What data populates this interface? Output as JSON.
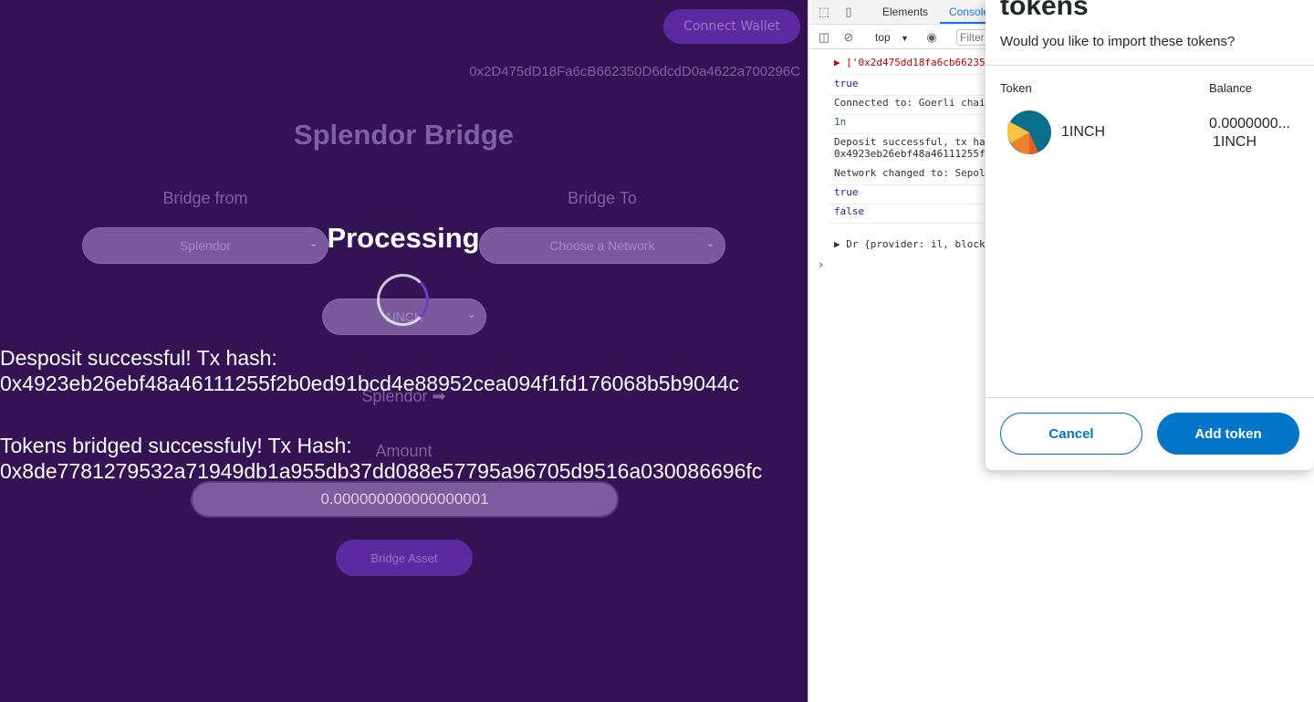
{
  "app": {
    "connect_button": "Connect Wallet",
    "wallet_address": "0x2D475dD18Fa6cB662350D6dcdD0a4622a700296C",
    "title": "Splendor Bridge",
    "bridge_from_label": "Bridge from",
    "bridge_to_label": "Bridge To",
    "from_network": "Splendor",
    "to_network": "Choose a Network",
    "processing_text": "Processing",
    "token_select": "1INCH",
    "direction_text": "Splendor ➡",
    "amount_label": "Amount",
    "amount_value": "0.000000000000000001",
    "bridge_button": "Bridge Asset",
    "deposit_msg_line1": "Desposit successful! Tx hash:",
    "deposit_msg_line2": "0x4923eb26ebf48a46111255f2b0ed91bcd4e88952cea094f1fd176068b5b9044c",
    "bridged_msg_line1": "Tokens bridged successfuly! Tx Hash:",
    "bridged_msg_line2": "0x8de7781279532a71949db1a955db37dd088e57795a96705d9516a030086696fc"
  },
  "devtools": {
    "tabs": [
      "Elements",
      "Console"
    ],
    "active_tab": "Console",
    "context": "top",
    "filter_placeholder": "Filter",
    "console_lines": [
      {
        "text": "▶ ['0x2d475dd18fa6cb66235",
        "color": "#c80000"
      },
      {
        "text": "true",
        "color": "#1a1aa6"
      },
      {
        "text": "Connected to: Goerli chai",
        "color": "#333333"
      },
      {
        "text": "1n",
        "color": "#236e25"
      },
      {
        "text": "Deposit successful, tx ha",
        "color": "#333333"
      },
      {
        "text": "0x4923eb26ebf48a46111255f",
        "color": "#333333"
      },
      {
        "text": "Network changed to: Sepol",
        "color": "#333333"
      },
      {
        "text": "true",
        "color": "#1a1aa6"
      },
      {
        "text": "false",
        "color": "#1a1aa6"
      },
      {
        "text": "▶ Dr {provider: il, block",
        "color": "#333333"
      }
    ]
  },
  "metamask": {
    "title": "tokens",
    "subtitle": "Would you like to import these tokens?",
    "col_token": "Token",
    "col_balance": "Balance",
    "token_name": "1INCH",
    "balance_line1": "0.0000000...",
    "balance_line2": "1INCH",
    "cancel_button": "Cancel",
    "add_button": "Add token"
  }
}
